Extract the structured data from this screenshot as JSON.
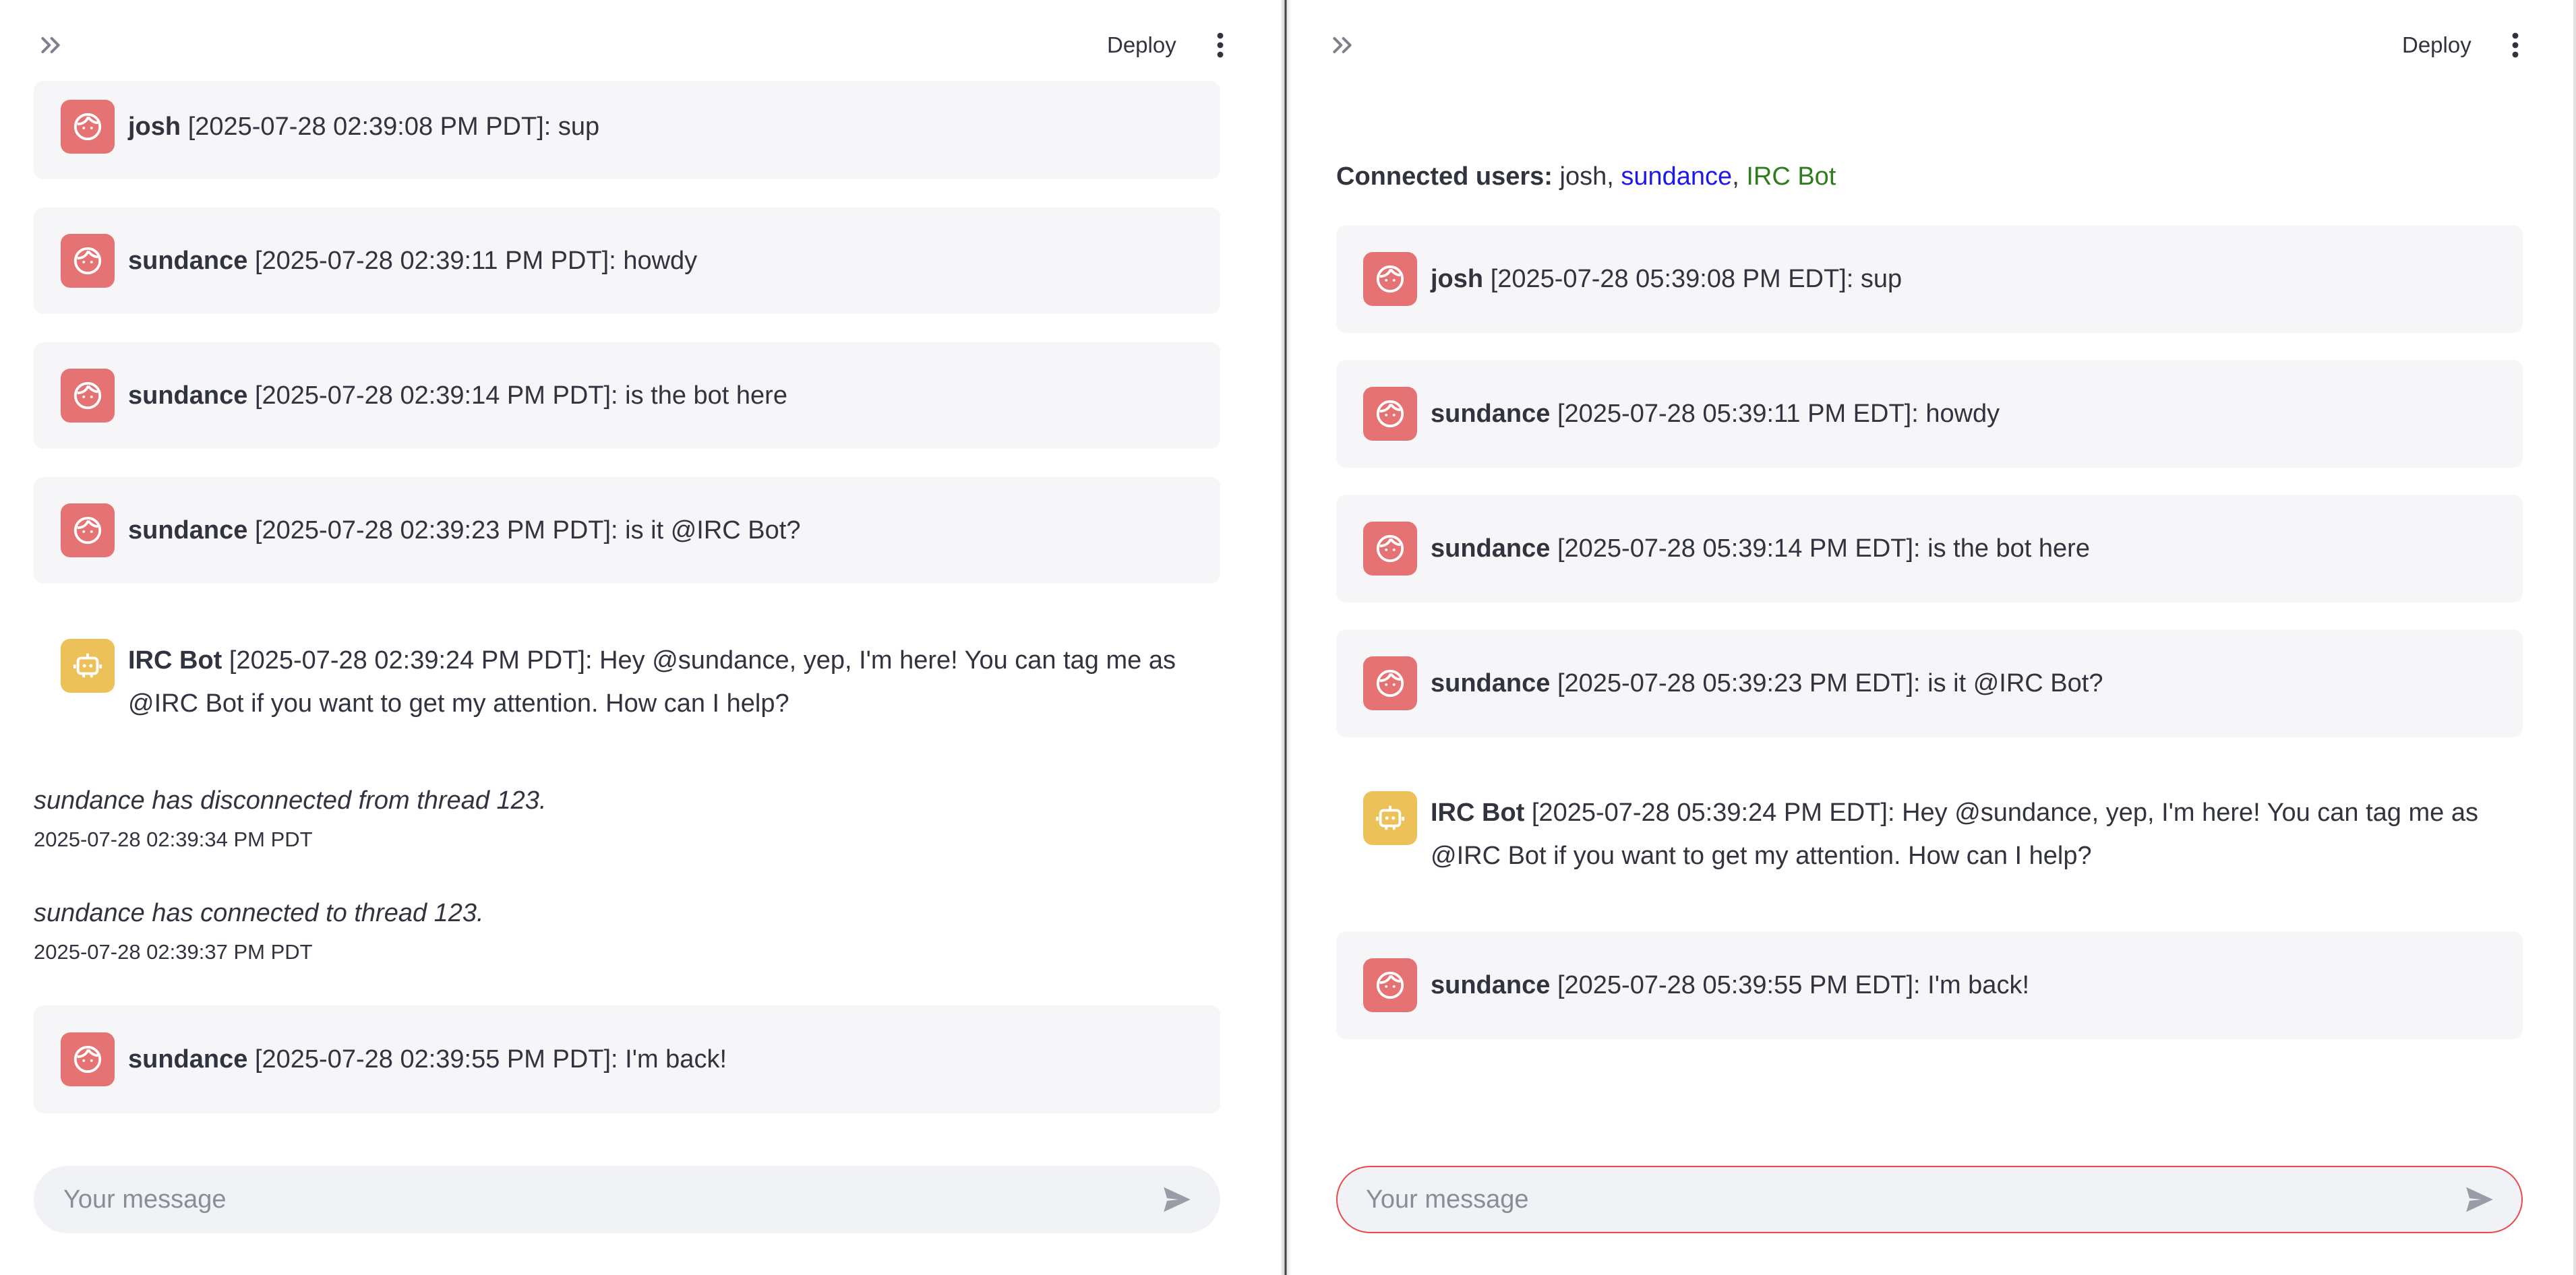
{
  "left": {
    "deploy_label": "Deploy",
    "messages": [
      {
        "author": "josh",
        "text": "[2025-07-28 02:39:08 PM PDT]: sup"
      },
      {
        "author": "sundance",
        "text": "[2025-07-28 02:39:11 PM PDT]: howdy"
      },
      {
        "author": "sundance",
        "text": "[2025-07-28 02:39:14 PM PDT]: is the bot here"
      },
      {
        "author": "sundance",
        "text": "[2025-07-28 02:39:23 PM PDT]: is it @IRC Bot?"
      },
      {
        "author": "IRC Bot",
        "text": "[2025-07-28 02:39:24 PM PDT]: Hey @sundance, yep, I'm here! You can tag me as @IRC Bot if you want to get my attention. How can I help?"
      },
      {
        "author": "sundance",
        "text": "[2025-07-28 02:39:55 PM PDT]: I'm back!"
      }
    ],
    "system_events": [
      {
        "text": "sundance has disconnected from thread 123.",
        "time": "2025-07-28 02:39:34 PM PDT"
      },
      {
        "text": "sundance has connected to thread 123.",
        "time": "2025-07-28 02:39:37 PM PDT"
      }
    ],
    "input_placeholder": "Your message"
  },
  "right": {
    "deploy_label": "Deploy",
    "connected_label": "Connected users:",
    "connected_users": [
      "josh",
      "sundance",
      "IRC Bot"
    ],
    "separator": ", ",
    "messages": [
      {
        "author": "josh",
        "text": "[2025-07-28 05:39:08 PM EDT]: sup"
      },
      {
        "author": "sundance",
        "text": "[2025-07-28 05:39:11 PM EDT]: howdy"
      },
      {
        "author": "sundance",
        "text": "[2025-07-28 05:39:14 PM EDT]: is the bot here"
      },
      {
        "author": "sundance",
        "text": "[2025-07-28 05:39:23 PM EDT]: is it @IRC Bot?"
      },
      {
        "author": "IRC Bot",
        "text": "[2025-07-28 05:39:24 PM EDT]: Hey @sundance, yep, I'm here! You can tag me as @IRC Bot if you want to get my attention. How can I help?"
      },
      {
        "author": "sundance",
        "text": "[2025-07-28 05:39:55 PM EDT]: I'm back!"
      }
    ],
    "input_placeholder": "Your message"
  },
  "colors": {
    "user_avatar": "#e57373",
    "bot_avatar": "#ecc15a",
    "sundance_name": "#1f18e8",
    "bot_name": "#2e7d1e",
    "focused_input_border": "#e84a4a"
  },
  "icons": {
    "user_avatar": "face-icon",
    "bot_avatar": "robot-icon",
    "sidebar_toggle": "double-chevron-right-icon",
    "menu": "vertical-dots-icon",
    "send": "send-icon"
  }
}
